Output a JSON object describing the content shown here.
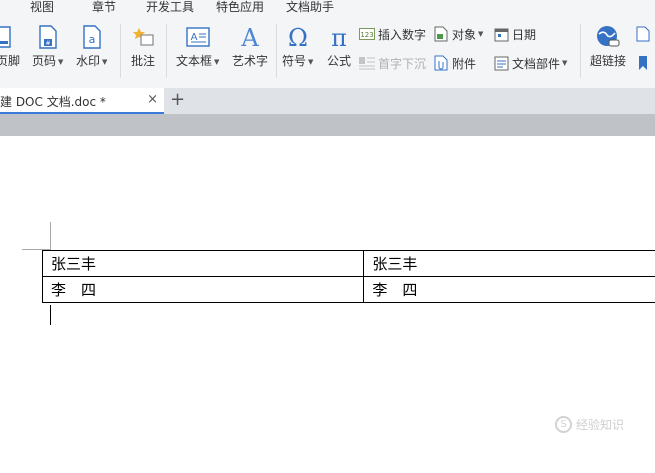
{
  "menu_tabs": [
    "视图",
    "章节",
    "开发工具",
    "特色应用",
    "文档助手"
  ],
  "ribbon": {
    "header_footer": "页脚",
    "page_number": "页码",
    "watermark": "水印",
    "comment": "批注",
    "text_box": "文本框",
    "word_art": "艺术字",
    "symbol": "符号",
    "formula": "公式",
    "insert_number": "插入数字",
    "drop_cap": "首字下沉",
    "object": "对象",
    "attachment": "附件",
    "date": "日期",
    "doc_parts": "文档部件",
    "hyperlink": "超链接"
  },
  "tab": {
    "title": "建 DOC 文档.doc *",
    "close": "×",
    "new_tab": "+"
  },
  "table": {
    "rows": [
      [
        "张三丰",
        "张三丰"
      ],
      [
        "李　四",
        "李　四"
      ]
    ]
  },
  "watermark_text": "经验知识",
  "colors": {
    "ribbon_bg": "#f4f5f7",
    "tab_accent": "#3b7ad8",
    "icon_blue": "#3572c4"
  }
}
